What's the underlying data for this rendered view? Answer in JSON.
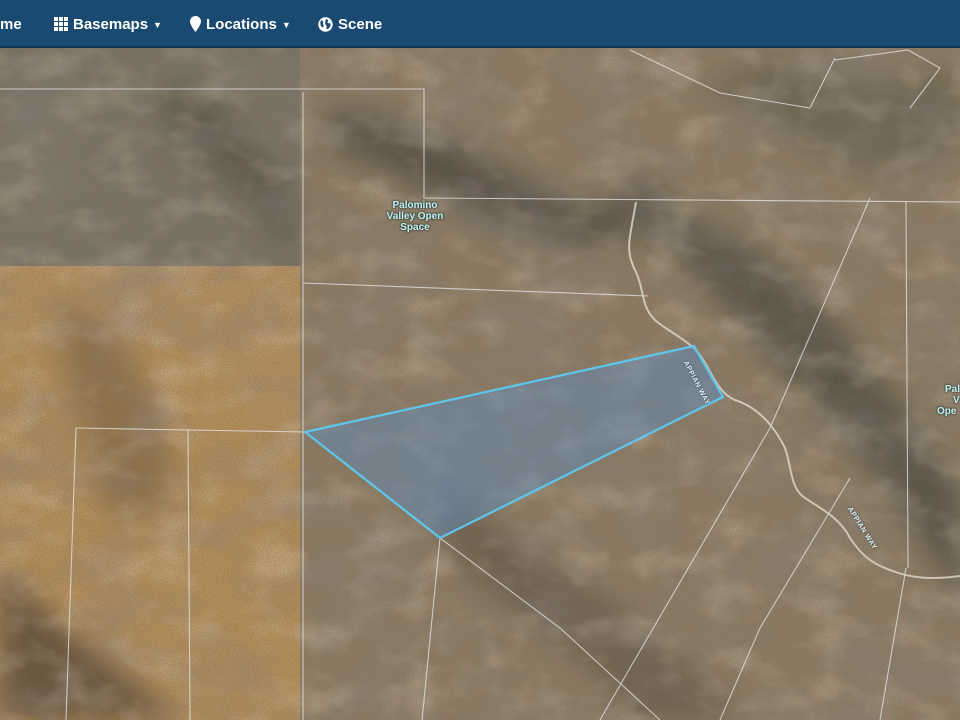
{
  "navbar": {
    "items": [
      {
        "label": "me",
        "icon": ""
      },
      {
        "label": "Basemaps",
        "icon": "grid-icon"
      },
      {
        "label": "Locations",
        "icon": "map-pin-icon"
      },
      {
        "label": "Scene",
        "icon": "globe-icon"
      }
    ]
  },
  "map": {
    "labels": {
      "open_space_main": [
        "Palomino",
        "Valley Open",
        "Space"
      ],
      "open_space_right": [
        "Pal",
        "V",
        "Ope"
      ],
      "road_1": "APPIAN WAY",
      "road_2": "APPIAN WAY"
    },
    "colors": {
      "navbar": "#1a4a72",
      "parcel_outline": "#5ec6ec",
      "parcel_fill": "#5a8cbf",
      "boundary_lines": "#e8e8e8"
    }
  }
}
